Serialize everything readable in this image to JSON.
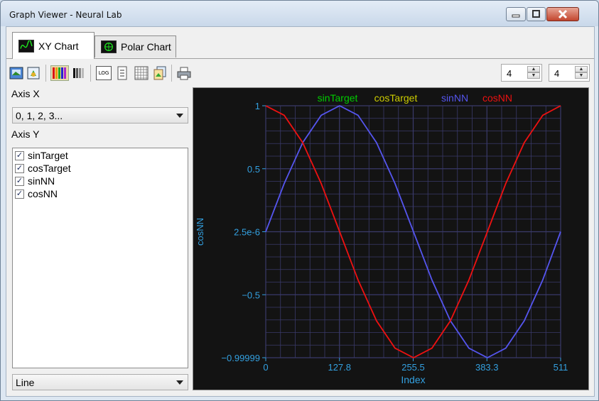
{
  "window": {
    "title": "Graph Viewer - Neural Lab"
  },
  "tabs": [
    {
      "label": "XY Chart",
      "active": true
    },
    {
      "label": "Polar Chart",
      "active": false
    }
  ],
  "toolbar": {
    "buttons": [
      "save-image-icon",
      "export-icon",
      "color-palette-icon",
      "grayscale-palette-icon",
      "log-scale-icon",
      "y-scale-icon",
      "grid-icon",
      "copy-icon",
      "print-icon"
    ],
    "log_label": "LOG",
    "spinner1_value": "4",
    "spinner2_value": "4"
  },
  "left": {
    "axis_x_label": "Axis X",
    "axis_x_value": "0, 1, 2, 3...",
    "axis_y_label": "Axis Y",
    "series_items": [
      {
        "label": "sinTarget",
        "checked": true
      },
      {
        "label": "cosTarget",
        "checked": true
      },
      {
        "label": "sinNN",
        "checked": true
      },
      {
        "label": "cosNN",
        "checked": true
      }
    ],
    "check_glyph": "✓",
    "chart_type_value": "Line"
  },
  "colors": {
    "sinTarget": "#00cc00",
    "cosTarget": "#cccc00",
    "sinNN": "#5555ee",
    "cosNN": "#ee1111",
    "axis_text": "#33a0e0",
    "grid": "#3a3a6a"
  },
  "chart_data": {
    "type": "line",
    "xlabel": "Index",
    "ylabel": "cosNN",
    "xlim": [
      0,
      511
    ],
    "ylim": [
      -0.99999,
      1
    ],
    "x_ticks": [
      "0",
      "127.8",
      "255.5",
      "383.3",
      "511"
    ],
    "y_ticks": [
      "1",
      "0.5",
      "2.5e-6",
      "−0.5",
      "−0.99999"
    ],
    "y_tick_values": [
      1,
      0.5,
      2.5e-06,
      -0.5,
      -0.99999
    ],
    "legend": [
      "sinTarget",
      "cosTarget",
      "sinNN",
      "cosNN"
    ],
    "legend_placement": "top",
    "grid": true,
    "series": [
      {
        "name": "sinNN",
        "x": [
          0,
          32,
          64,
          96,
          128,
          160,
          192,
          224,
          256,
          288,
          320,
          352,
          384,
          416,
          448,
          480,
          511
        ],
        "values": [
          0,
          0.383,
          0.707,
          0.924,
          1,
          0.924,
          0.707,
          0.383,
          0,
          -0.383,
          -0.707,
          -0.924,
          -1,
          -0.924,
          -0.707,
          -0.383,
          0
        ]
      },
      {
        "name": "cosNN",
        "x": [
          0,
          32,
          64,
          96,
          128,
          160,
          192,
          224,
          256,
          288,
          320,
          352,
          384,
          416,
          448,
          480,
          511
        ],
        "values": [
          1,
          0.924,
          0.707,
          0.383,
          0,
          -0.383,
          -0.707,
          -0.924,
          -1,
          -0.924,
          -0.707,
          -0.383,
          0,
          0.383,
          0.707,
          0.924,
          1
        ]
      }
    ]
  }
}
